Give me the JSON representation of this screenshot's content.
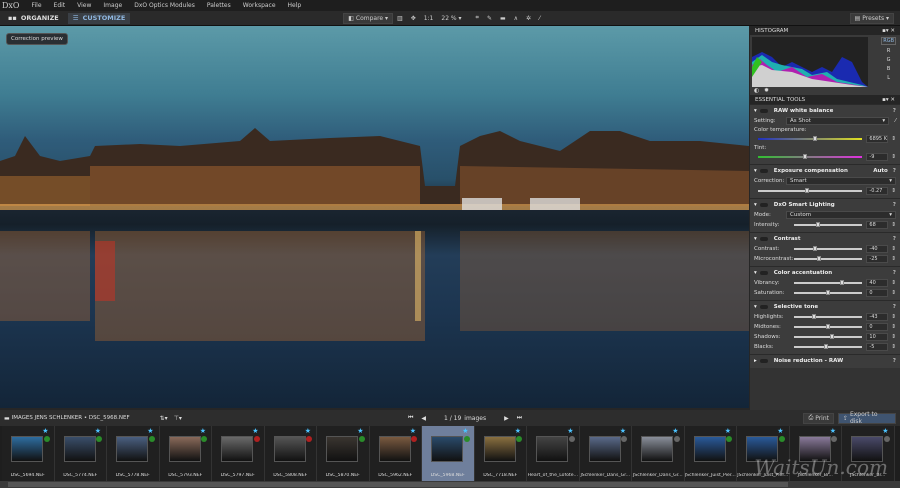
{
  "app": {
    "logo": "DxO",
    "menus": [
      "File",
      "Edit",
      "View",
      "Image",
      "DxO Optics Modules",
      "Palettes",
      "Workspace",
      "Help"
    ]
  },
  "toolbar": {
    "organize": "ORGANIZE",
    "customize": "CUSTOMIZE",
    "compare": "Compare",
    "one_to_one": "1:1",
    "zoom": "22 %",
    "presets": "Presets"
  },
  "viewer": {
    "correction_preview": "Correction preview"
  },
  "histogram": {
    "title": "HISTOGRAM",
    "channels": [
      "RGB",
      "R",
      "G",
      "B",
      "L"
    ],
    "selected_channel": "RGB"
  },
  "essential": {
    "title": "ESSENTIAL TOOLS",
    "tools": [
      {
        "name": "RAW white balance",
        "help": "?",
        "selects": [
          {
            "label": "Setting:",
            "value": "As Shot"
          }
        ],
        "sliders": [
          {
            "label": "Color temperature:",
            "value": "6895 K",
            "pos": 0.55,
            "track": "temp"
          },
          {
            "label": "Tint:",
            "value": "-9",
            "pos": 0.45,
            "track": "tint"
          }
        ]
      },
      {
        "name": "Exposure compensation",
        "extra": "Auto",
        "help": "?",
        "selects": [
          {
            "label": "Correction:",
            "value": "Smart"
          }
        ],
        "sliders": [
          {
            "label": "",
            "value": "-0.27",
            "pos": 0.47
          }
        ]
      },
      {
        "name": "DxO Smart Lighting",
        "help": "?",
        "selects": [
          {
            "label": "Mode:",
            "value": "Custom"
          }
        ],
        "sliders": [
          {
            "label": "Intensity:",
            "value": "68",
            "pos": 0.35
          }
        ]
      },
      {
        "name": "Contrast",
        "help": "?",
        "sliders": [
          {
            "label": "Contrast:",
            "value": "-40",
            "pos": 0.3
          },
          {
            "label": "Microcontrast:",
            "value": "-25",
            "pos": 0.37
          }
        ]
      },
      {
        "name": "Color accentuation",
        "help": "?",
        "sliders": [
          {
            "label": "Vibrancy:",
            "value": "40",
            "pos": 0.7
          },
          {
            "label": "Saturation:",
            "value": "0",
            "pos": 0.5
          }
        ]
      },
      {
        "name": "Selective tone",
        "help": "?",
        "sliders": [
          {
            "label": "Highlights:",
            "value": "-43",
            "pos": 0.29
          },
          {
            "label": "Midtones:",
            "value": "0",
            "pos": 0.5
          },
          {
            "label": "Shadows:",
            "value": "10",
            "pos": 0.55
          },
          {
            "label": "Blacks:",
            "value": "-5",
            "pos": 0.47
          }
        ]
      },
      {
        "name": "Noise reduction - RAW",
        "help": "?",
        "collapsed": true
      }
    ]
  },
  "pathbar": {
    "folder": "IMAGES JENS SCHLENKER",
    "file": "DSC_5968.NEF",
    "count": "1 / 19",
    "count_label": "images",
    "print": "Print",
    "export": "Export to disk"
  },
  "filmstrip": [
    {
      "name": "DSC_5694.NEF",
      "c": "#2e6da0",
      "status": "ok"
    },
    {
      "name": "DSC_5774.NEF",
      "c": "#3a4e6a",
      "status": "ok"
    },
    {
      "name": "DSC_5778.NEF",
      "c": "#4a5f80",
      "status": "ok"
    },
    {
      "name": "DSC_5793.NEF",
      "c": "#8a6a5a",
      "status": "ok"
    },
    {
      "name": "DSC_5797.NEF",
      "c": "#6a6a6a",
      "status": "bad"
    },
    {
      "name": "DSC_5808.NEF",
      "c": "#555",
      "status": "bad"
    },
    {
      "name": "DSC_5870.NEF",
      "c": "#3a3530",
      "status": "ok"
    },
    {
      "name": "DSC_5962.NEF",
      "c": "#7a5a40",
      "status": "bad"
    },
    {
      "name": "DSC_5968.NEF",
      "c": "#2a4a6a",
      "status": "ok",
      "selected": true
    },
    {
      "name": "DSC_7718.NEF",
      "c": "#8a7040",
      "status": "ok"
    },
    {
      "name": "Heart_of_the_Lofote...",
      "c": "#444",
      "status": "none"
    },
    {
      "name": "JSchlenker_Dans_Gr...",
      "c": "#5a6a8a",
      "status": "none"
    },
    {
      "name": "JSchlenker_Dans_Gr...",
      "c": "#8a8f9a",
      "status": "none"
    },
    {
      "name": "JSchlenker_Juist_Pier...",
      "c": "#2a5a9a",
      "status": "ok"
    },
    {
      "name": "JSchlenker_Juist_Pier...",
      "c": "#2a5a9a",
      "status": "ok"
    },
    {
      "name": "JSchlenker_Br...",
      "c": "#8a7a9a",
      "status": "none"
    },
    {
      "name": "JSchlenker_Br...",
      "c": "#4a4a6a",
      "status": "none"
    }
  ],
  "watermark": "WaitsUn.com"
}
